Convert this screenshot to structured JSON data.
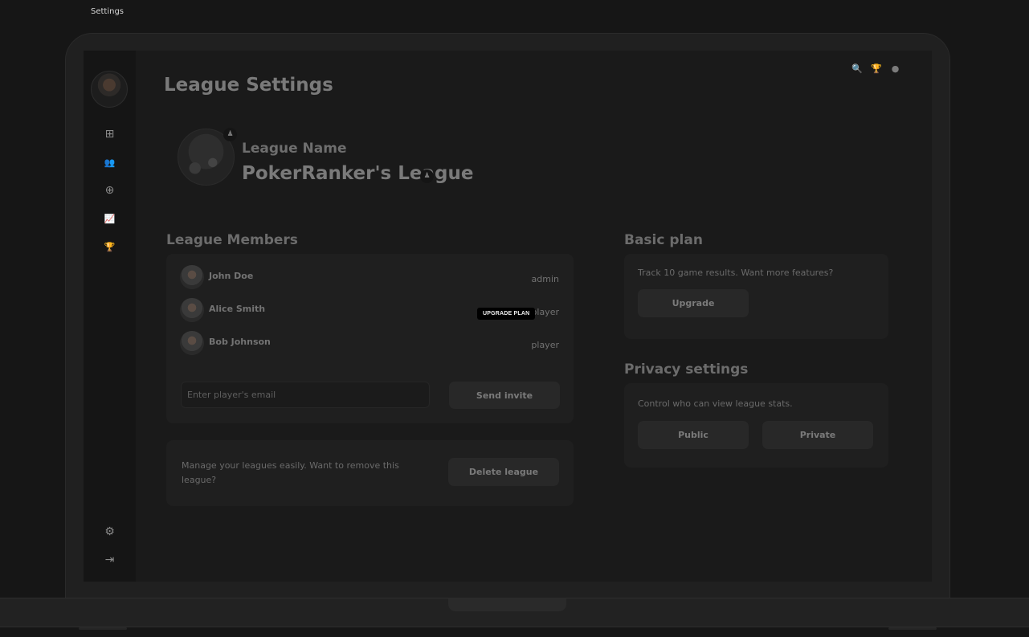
{
  "window": {
    "title": "Settings"
  },
  "sidebar": {
    "items": [
      {
        "icon": "dashboard-grid-icon",
        "glyph": "⊞"
      },
      {
        "icon": "users-icon",
        "glyph": "👥"
      },
      {
        "icon": "add-circle-icon",
        "glyph": "⊕"
      },
      {
        "icon": "chart-line-icon",
        "glyph": "📈"
      },
      {
        "icon": "trophy-icon",
        "glyph": "🏆"
      }
    ],
    "bottom_items": [
      {
        "icon": "gear-icon",
        "glyph": "⚙"
      },
      {
        "icon": "logout-icon",
        "glyph": "⇥"
      }
    ]
  },
  "header": {
    "title": "League Settings",
    "icons": [
      {
        "icon": "search-icon",
        "glyph": "🔍"
      },
      {
        "icon": "trophy-icon",
        "glyph": "🏆"
      },
      {
        "icon": "globe-icon",
        "glyph": "●"
      }
    ]
  },
  "league": {
    "label": "League Name",
    "name": "PokerRanker's League"
  },
  "members": {
    "title": "League Members",
    "rows": [
      {
        "name": "John Doe",
        "role": "admin"
      },
      {
        "name": "Alice Smith",
        "role": "player"
      },
      {
        "name": "Bob Johnson",
        "role": "player"
      }
    ],
    "email_placeholder": "Enter player's email",
    "send_invite_label": "Send invite"
  },
  "tooltip": {
    "text": "UPGRADE PLAN"
  },
  "danger": {
    "description": "Manage your leagues easily. Want to remove this league?",
    "delete_label": "Delete league"
  },
  "plan": {
    "title": "Basic plan",
    "description": "Track 10 game results. Want more features?",
    "upgrade_label": "Upgrade"
  },
  "privacy": {
    "title": "Privacy settings",
    "description": "Control who can view league stats.",
    "public_label": "Public",
    "private_label": "Private"
  }
}
